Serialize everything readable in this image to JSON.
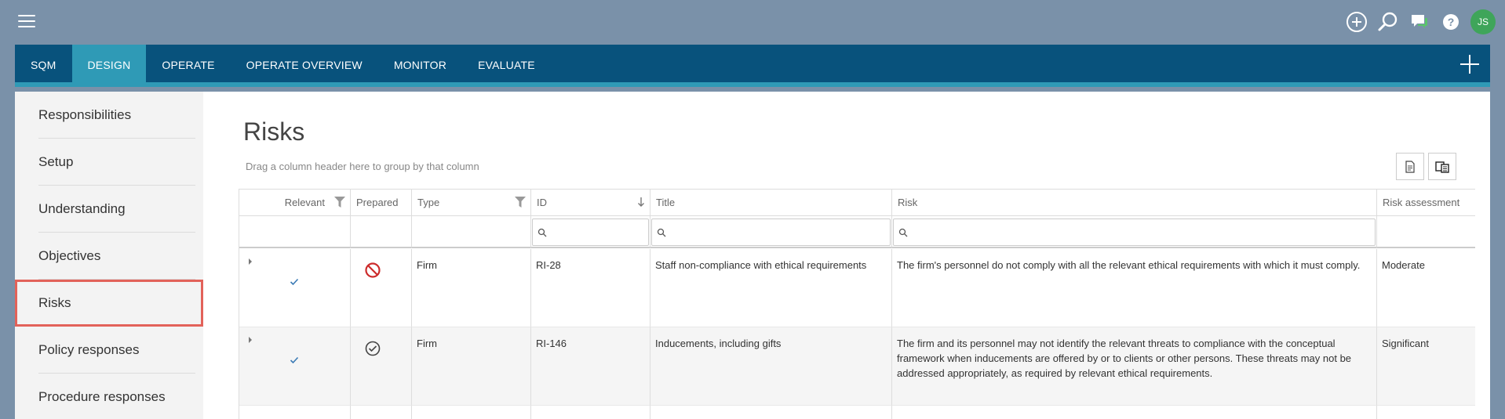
{
  "user": {
    "initials": "JS"
  },
  "nav": {
    "tabs": [
      {
        "label": "SQM",
        "active": false
      },
      {
        "label": "DESIGN",
        "active": true
      },
      {
        "label": "OPERATE",
        "active": false
      },
      {
        "label": "OPERATE OVERVIEW",
        "active": false
      },
      {
        "label": "MONITOR",
        "active": false
      },
      {
        "label": "EVALUATE",
        "active": false
      }
    ]
  },
  "sidebar": {
    "items": [
      {
        "label": "Responsibilities"
      },
      {
        "label": "Setup"
      },
      {
        "label": "Understanding"
      },
      {
        "label": "Objectives"
      },
      {
        "label": "Risks",
        "active": true
      },
      {
        "label": "Policy responses"
      },
      {
        "label": "Procedure responses"
      }
    ]
  },
  "main": {
    "title": "Risks",
    "group_hint": "Drag a column header here to group by that column"
  },
  "grid": {
    "columns": [
      "Relevant",
      "Prepared",
      "Type",
      "ID",
      "Title",
      "Risk",
      "Risk assessment"
    ],
    "sort": {
      "column": "ID",
      "direction": "descending"
    },
    "rows": [
      {
        "relevant": true,
        "prepared": "not-prepared",
        "type": "Firm",
        "id": "RI-28",
        "title": "Staff non-compliance with ethical requirements",
        "risk": "The firm's personnel do not comply with all the relevant ethical requirements with which it must comply.",
        "assessment": "Moderate"
      },
      {
        "relevant": true,
        "prepared": "prepared",
        "type": "Firm",
        "id": "RI-146",
        "title": "Inducements, including gifts",
        "risk": "The firm and its personnel may not identify the relevant threats to compliance with the conceptual framework when inducements are offered by or to clients or other persons. These threats may not be addressed appropriately, as required by relevant ethical requirements.",
        "assessment": "Significant"
      }
    ]
  },
  "colors": {
    "nav_bg": "#08527c",
    "accent": "#2f9ab6",
    "active_outline": "#e2625a",
    "avatar": "#3fa55a"
  }
}
